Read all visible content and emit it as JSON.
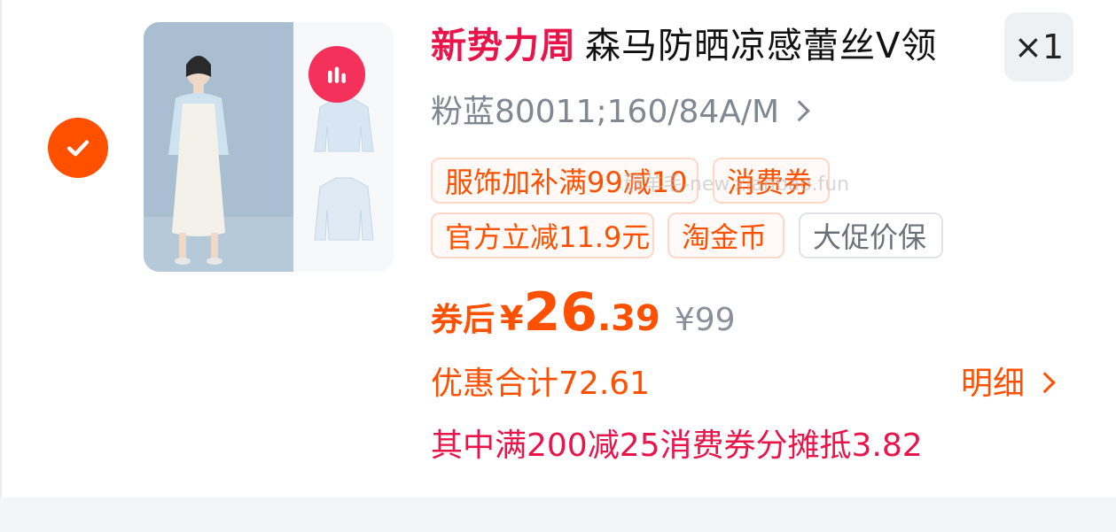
{
  "item": {
    "selected": true,
    "title_tag": "新势力周",
    "title_name": "森马防晒凉感蕾丝V领",
    "quantity": "×1",
    "sku": "粉蓝80011;160/84A/M",
    "chips": [
      "服饰加补满99减10",
      "消费券",
      "官方立减11.9元",
      "淘金币",
      "大促价保"
    ],
    "watermark": "薅羊毛-new.xianbao.fun",
    "price_after_label": "券后",
    "currency": "¥",
    "price_int": "26",
    "price_dec": ".39",
    "original_price": "¥99",
    "discount_total": "优惠合计72.61",
    "detail_label": "明细",
    "coupon_share": "其中满200减25消费券分摊抵3.82"
  },
  "colors": {
    "accent_orange": "#ff5000",
    "accent_red": "#e8144a",
    "muted": "#7f8790",
    "app_badge": "#f3315a"
  },
  "icons": {
    "check": "check-icon",
    "badge": "app-badge-icon",
    "chevron": "chevron-right-icon"
  }
}
